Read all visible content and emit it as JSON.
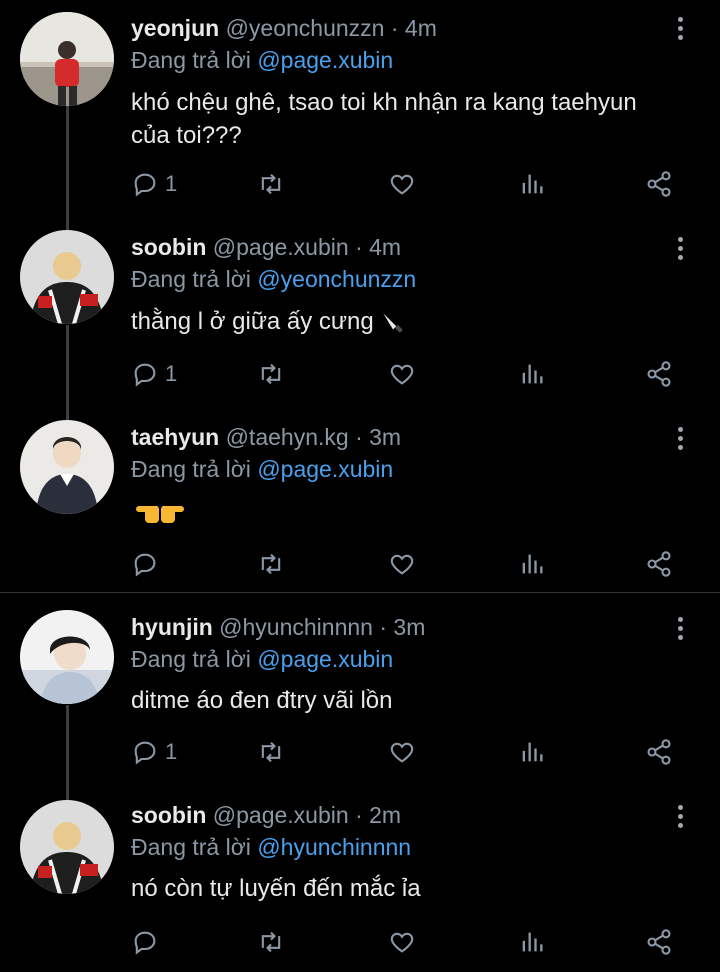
{
  "replying_label": "Đang trả lời",
  "tweets": [
    {
      "name": "yeonjun",
      "handle": "@yeonchunzzn",
      "time": "4m",
      "reply_to": "@page.xubin",
      "text_line1": "khó chệu ghê, tsao toi kh nhận ra kang taehyun",
      "text_line2": "của toi???",
      "reply_count": "1"
    },
    {
      "name": "soobin",
      "handle": "@page.xubin",
      "time": "4m",
      "reply_to": "@yeonchunzzn",
      "text": "thằng l ở giữa ấy cưng",
      "reply_count": "1"
    },
    {
      "name": "taehyun",
      "handle": "@taehyn.kg",
      "time": "3m",
      "reply_to": "@page.xubin",
      "text": "",
      "reply_count": ""
    },
    {
      "name": "hyunjin",
      "handle": "@hyunchinnnn",
      "time": "3m",
      "reply_to": "@page.xubin",
      "text": "ditme áo đen đtry vãi lồn",
      "reply_count": "1"
    },
    {
      "name": "soobin",
      "handle": "@page.xubin",
      "time": "2m",
      "reply_to": "@hyunchinnnn",
      "text": "nó còn tự luyến đến mắc ỉa",
      "reply_count": ""
    }
  ],
  "icons": {
    "reply": "reply-icon",
    "retweet": "retweet-icon",
    "like": "heart-icon",
    "views": "analytics-icon",
    "share": "share-icon",
    "more": "more-vertical-icon"
  },
  "colors": {
    "background": "#000000",
    "mention": "#4aa0ec",
    "muted": "#8b98a5",
    "thread": "#3a3f44"
  }
}
